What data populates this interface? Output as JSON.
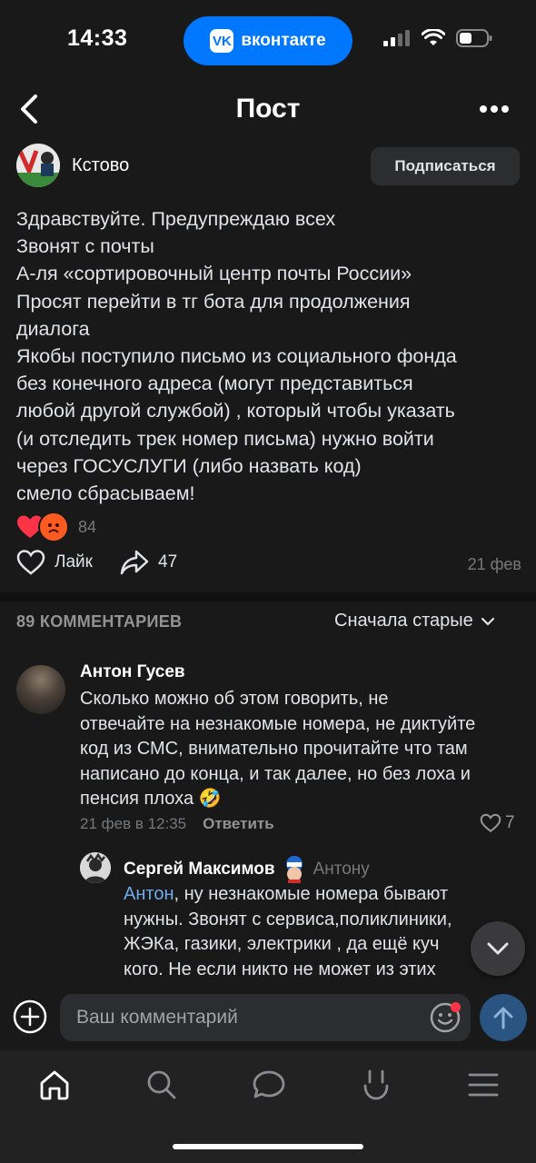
{
  "status_bar": {
    "time": "14:33",
    "app_pill": "вконтакте",
    "app_logo": "vk"
  },
  "header": {
    "title": "Пост",
    "back_icon": "chevron-left-icon",
    "more_icon": "more-icon"
  },
  "post": {
    "group_name": "Кстово",
    "subscribe_label": "Подписаться",
    "text_lines": [
      "Здравствуйте. Предупреждаю всех",
      "Звонят с почты",
      "А-ля «сортировочный центр почты России»",
      "Просят перейти в тг бота для продолжения",
      "диалога",
      "Якобы поступило письмо из социального фонда",
      "без конечного адреса (могут представиться",
      "любой другой службой) , который чтобы указать",
      "(и отследить трек номер письма) нужно войти",
      "через ГОСУСЛУГИ (либо назвать код)",
      "смело сбрасываем!"
    ],
    "reactions_count": "84",
    "like_label": "Лайк",
    "share_count": "47",
    "date": "21 фев"
  },
  "comments_section": {
    "count_label": "89 КОММЕНТАРИЕВ",
    "sort_label": "Сначала старые"
  },
  "comments": [
    {
      "author": "Антон Гусев",
      "text_lines": [
        "Сколько можно об этом говорить, не",
        "отвечайте на незнакомые номера, не диктуйте",
        "код из СМС, внимательно прочитайте что там",
        "написано до конца, и так далее, но без лоха и",
        "пенсия плоха 🤣"
      ],
      "date": "21 фев в 12:35",
      "reply_label": "Ответить",
      "likes": "7"
    },
    {
      "author": "Сергей Максимов",
      "reply_to": "Антону",
      "mention": "Антон",
      "first_line_rest": ", ну незнакомые номера бывают",
      "text_lines": [
        "нужны. Звонят с сервиса,поликлиники,",
        "ЖЭКа, газики, электрики , да ещё куч",
        "кого. Не если никто не может из этих"
      ]
    }
  ],
  "composer": {
    "placeholder": "Ваш комментарий"
  },
  "colors": {
    "background": "#19191a",
    "accent": "#0077ff",
    "mention": "#71aaeb",
    "heart": "#ff3347"
  },
  "tabbar": {
    "icons": [
      "home-icon",
      "search-icon",
      "messages-icon",
      "clips-icon",
      "menu-icon"
    ]
  }
}
